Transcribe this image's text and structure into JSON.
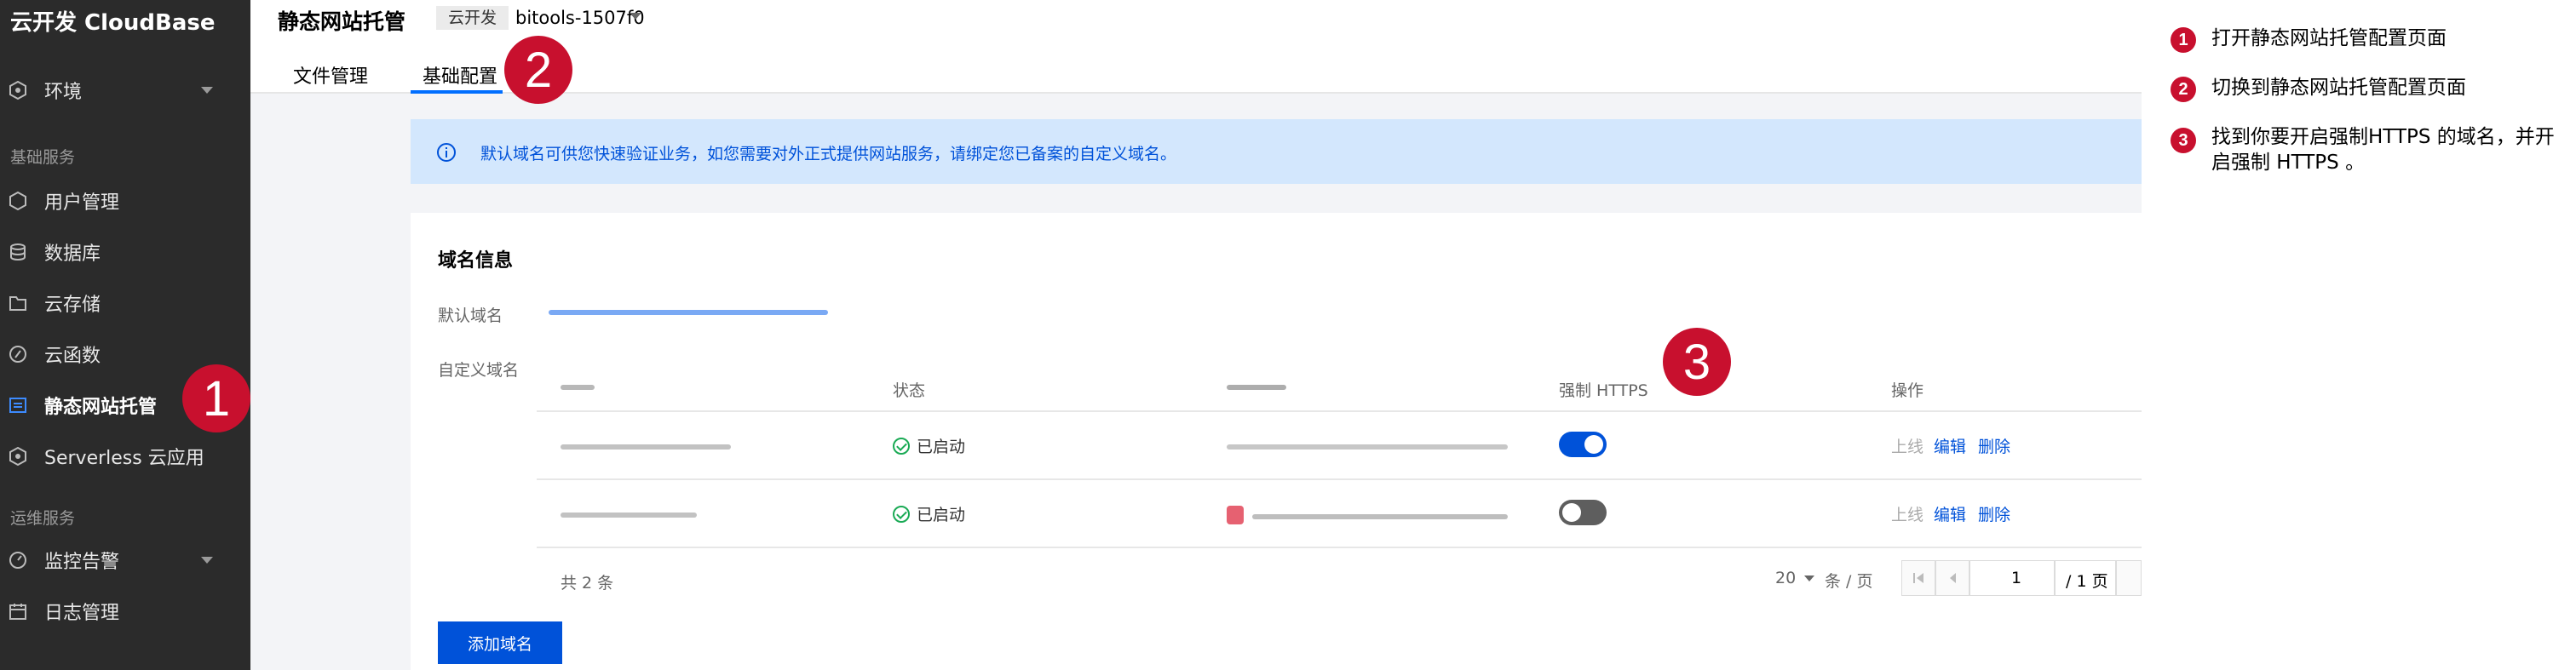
{
  "sidebar": {
    "brand": "云开发 CloudBase",
    "env_label": "环境",
    "section_basic": "基础服务",
    "items": [
      {
        "label": "用户管理"
      },
      {
        "label": "数据库"
      },
      {
        "label": "云存储"
      },
      {
        "label": "云函数"
      },
      {
        "label": "静态网站托管"
      },
      {
        "label": "Serverless 云应用"
      }
    ],
    "section_ops": "运维服务",
    "ops_items": [
      {
        "label": "监控告警"
      },
      {
        "label": "日志管理"
      }
    ]
  },
  "header": {
    "title": "静态网站托管",
    "env_tag": "云开发",
    "env_id": "bitools-1507f0"
  },
  "tabs": [
    {
      "label": "文件管理"
    },
    {
      "label": "基础配置"
    }
  ],
  "notice": "默认域名可供您快速验证业务，如您需要对外正式提供网站服务，请绑定您已备案的自定义域名。",
  "domain_card": {
    "title": "域名信息",
    "default_domain_label": "默认域名",
    "custom_domain_label": "自定义域名",
    "columns": {
      "status": "状态",
      "https": "强制 HTTPS",
      "actions": "操作"
    },
    "rows": [
      {
        "status": "已启动",
        "https_enabled": true,
        "actions": [
          "上线",
          "编辑",
          "删除"
        ]
      },
      {
        "status": "已启动",
        "https_enabled": false,
        "actions": [
          "上线",
          "编辑",
          "删除"
        ]
      }
    ],
    "total": "共 2 条",
    "page_size": "20",
    "page_unit": "条 / 页",
    "page_current": "1",
    "page_total": "/ 1 页",
    "add_button": "添加域名"
  },
  "markers": [
    "1",
    "2",
    "3"
  ],
  "annotations": [
    {
      "num": "1",
      "text": "打开静态网站托管配置页面"
    },
    {
      "num": "2",
      "text": "切换到静态网站托管配置页面"
    },
    {
      "num": "3",
      "text": "找到你要开启强制HTTPS 的域名，并开启强制 HTTPS 。"
    }
  ],
  "colors": {
    "sidebar_bg": "#2b2b2b",
    "accent": "#0052d9",
    "marker": "#c8102e",
    "success": "#1aaa55"
  }
}
